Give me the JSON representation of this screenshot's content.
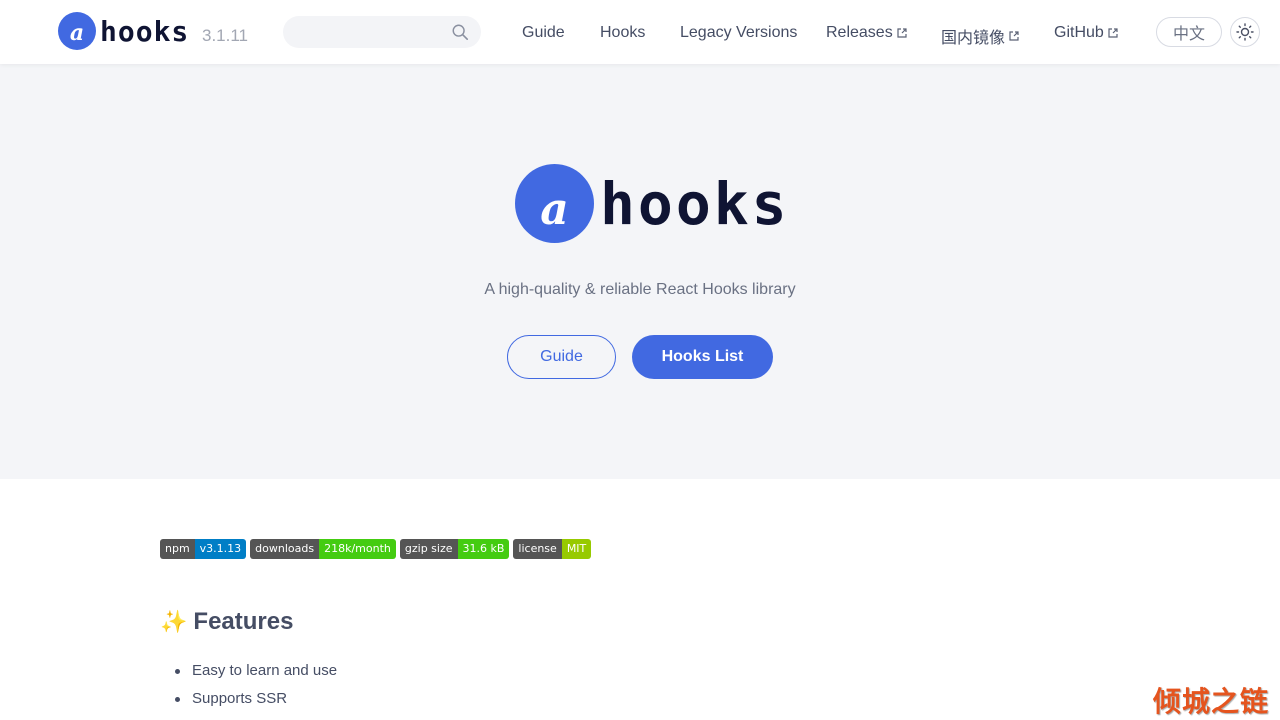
{
  "header": {
    "logo_letter": "a",
    "logo_text": "hooks",
    "version": "3.1.11",
    "search": {
      "placeholder": "",
      "icon": "search-icon"
    },
    "nav": [
      {
        "label": "Guide",
        "external": false
      },
      {
        "label": "Hooks",
        "external": false
      },
      {
        "label": "Legacy Versions",
        "external": false
      },
      {
        "label": "Releases",
        "external": true
      },
      {
        "label": "国内镜像",
        "external": true
      },
      {
        "label": "GitHub",
        "external": true
      }
    ],
    "lang_button": "中文",
    "theme_icon": "sun-icon"
  },
  "hero": {
    "logo_letter": "a",
    "logo_text": "hooks",
    "tagline": "A high-quality & reliable React Hooks library",
    "primary_button": "Hooks List",
    "secondary_button": "Guide",
    "accent_color": "#4169e1"
  },
  "badges": [
    {
      "label": "npm",
      "value": "v3.1.13",
      "color": "#007ec6"
    },
    {
      "label": "downloads",
      "value": "218k/month",
      "color": "#4c1"
    },
    {
      "label": "gzip size",
      "value": "31.6 kB",
      "color": "#4c1"
    },
    {
      "label": "license",
      "value": "MIT",
      "color": "#97ca00"
    }
  ],
  "features": {
    "emoji": "✨",
    "title": "Features",
    "items": [
      "Easy to learn and use",
      "Supports SSR"
    ]
  },
  "watermark": "倾城之链"
}
